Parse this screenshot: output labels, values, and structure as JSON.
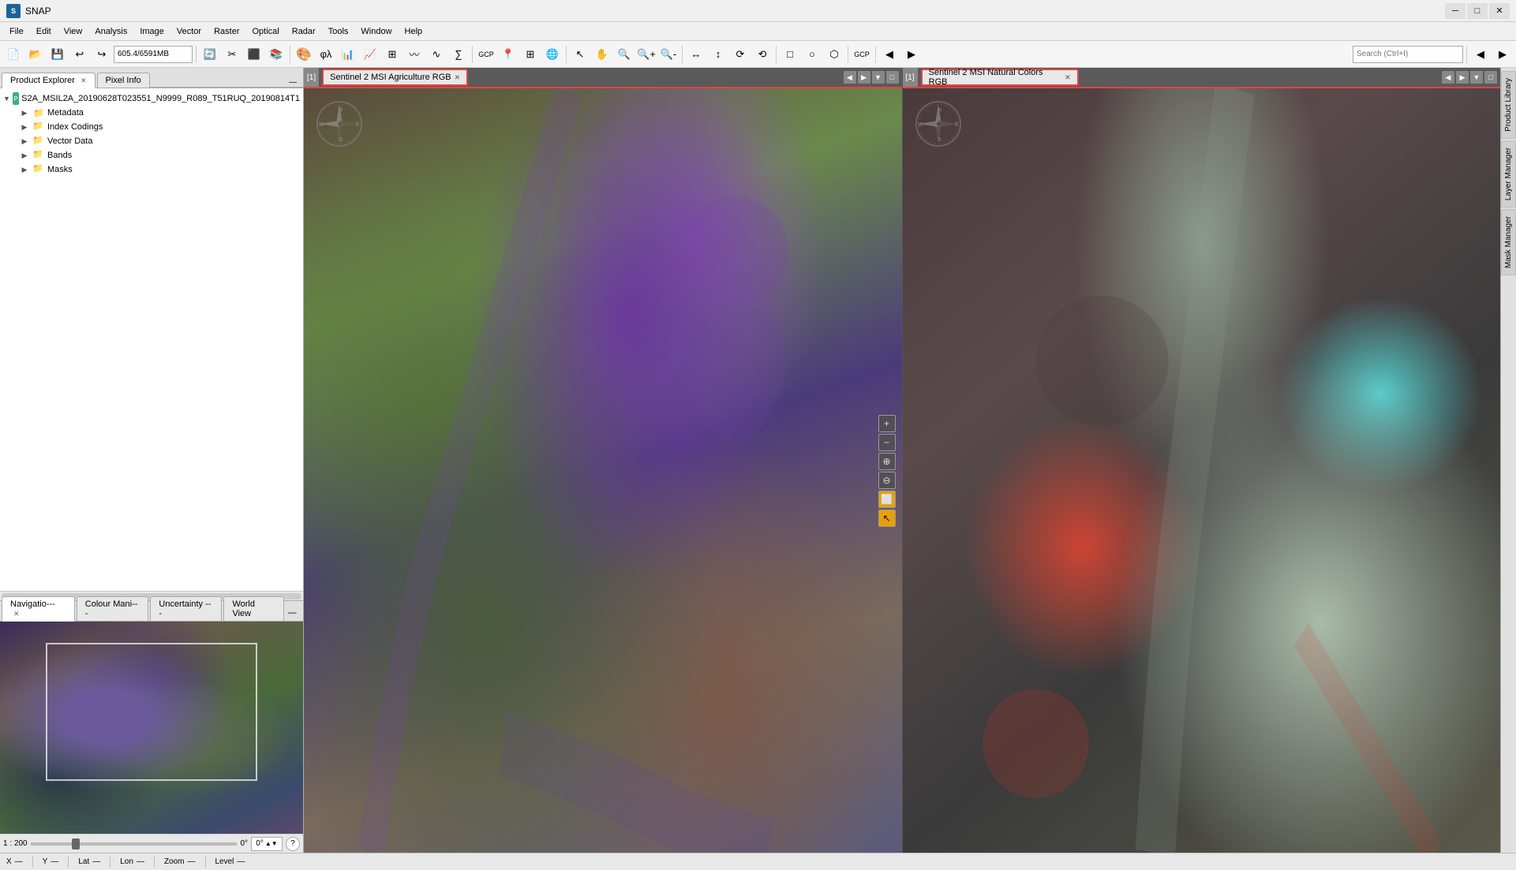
{
  "titlebar": {
    "app_name": "SNAP",
    "icon_text": "S"
  },
  "menubar": {
    "items": [
      "File",
      "Edit",
      "View",
      "Analysis",
      "Image",
      "Vector",
      "Raster",
      "Optical",
      "Radar",
      "Tools",
      "Window",
      "Help"
    ]
  },
  "toolbar": {
    "coord_value": "605.4/6591MB",
    "search_placeholder": "Search (Ctrl+I)",
    "buttons": [
      "📁",
      "💾",
      "↩",
      "↪",
      "📷",
      "🔧",
      "📤",
      "📥",
      "▶",
      "⚡",
      "📊",
      "📈",
      "🔲",
      "📋",
      "✕",
      "∑",
      "⊕",
      "🔑",
      "📍",
      "▦",
      "🖥",
      "📌",
      "✋",
      "🔍",
      "🔍+",
      "🔍-",
      "↕",
      "⇔",
      "⟳",
      "📐",
      "🖊",
      "📏",
      "✏",
      "🔲",
      "▦",
      "⬛",
      "◻",
      "⊞"
    ]
  },
  "left_panel": {
    "top_tabs": [
      {
        "label": "Product Explorer",
        "closable": true,
        "active": true
      },
      {
        "label": "Pixel Info",
        "closable": false,
        "active": false
      }
    ],
    "tree": [
      {
        "id": "root",
        "label": "S2A_MSIL2A_20190628T023551_N9999_R089_T51RUQ_20190814T1",
        "level": 0,
        "expanded": true,
        "icon": "product"
      },
      {
        "id": "metadata",
        "label": "Metadata",
        "level": 1,
        "expanded": false,
        "icon": "folder"
      },
      {
        "id": "index_codings",
        "label": "Index Codings",
        "level": 1,
        "expanded": false,
        "icon": "folder"
      },
      {
        "id": "vector_data",
        "label": "Vector Data",
        "level": 1,
        "expanded": false,
        "icon": "folder"
      },
      {
        "id": "bands",
        "label": "Bands",
        "level": 1,
        "expanded": false,
        "icon": "folder"
      },
      {
        "id": "masks",
        "label": "Masks",
        "level": 1,
        "expanded": false,
        "icon": "folder"
      }
    ],
    "bottom_tabs": [
      {
        "label": "Navigatio---",
        "closable": true,
        "active": true
      },
      {
        "label": "Colour Mani---",
        "closable": false,
        "active": false
      },
      {
        "label": "Uncertainty ---",
        "closable": false,
        "active": false
      },
      {
        "label": "World View",
        "closable": false,
        "active": false
      }
    ],
    "zoom_scale": "1 : 200",
    "zoom_angle": "0°",
    "help_icon": "?"
  },
  "view_panes": [
    {
      "id": "view1",
      "index": "1",
      "tab_label": "Sentinel 2 MSI Agriculture RGB",
      "highlighted": true,
      "nav_arrows": [
        "◀",
        "▶",
        "▼"
      ],
      "img_type": "agriculture"
    },
    {
      "id": "view2",
      "index": "1",
      "tab_label": "Sentinel 2 MSI Natural Colors RGB",
      "highlighted": true,
      "nav_arrows": [
        "◀",
        "▶",
        "▼"
      ],
      "img_type": "natural"
    }
  ],
  "right_sidebar_tabs": [
    "Product Library",
    "Layer Manager",
    "Mask Manager"
  ],
  "statusbar": {
    "x_label": "X",
    "x_sep": "—",
    "y_label": "Y",
    "y_sep": "—",
    "lat_label": "Lat",
    "lat_sep": "—",
    "lon_label": "Lon",
    "lon_sep": "—",
    "zoom_label": "Zoom",
    "zoom_sep": "—",
    "level_label": "Level",
    "level_sep": "—"
  },
  "zoom_tools": {
    "buttons": [
      "+",
      "−",
      "⊕",
      "⊖",
      "⬜",
      "↖"
    ]
  }
}
